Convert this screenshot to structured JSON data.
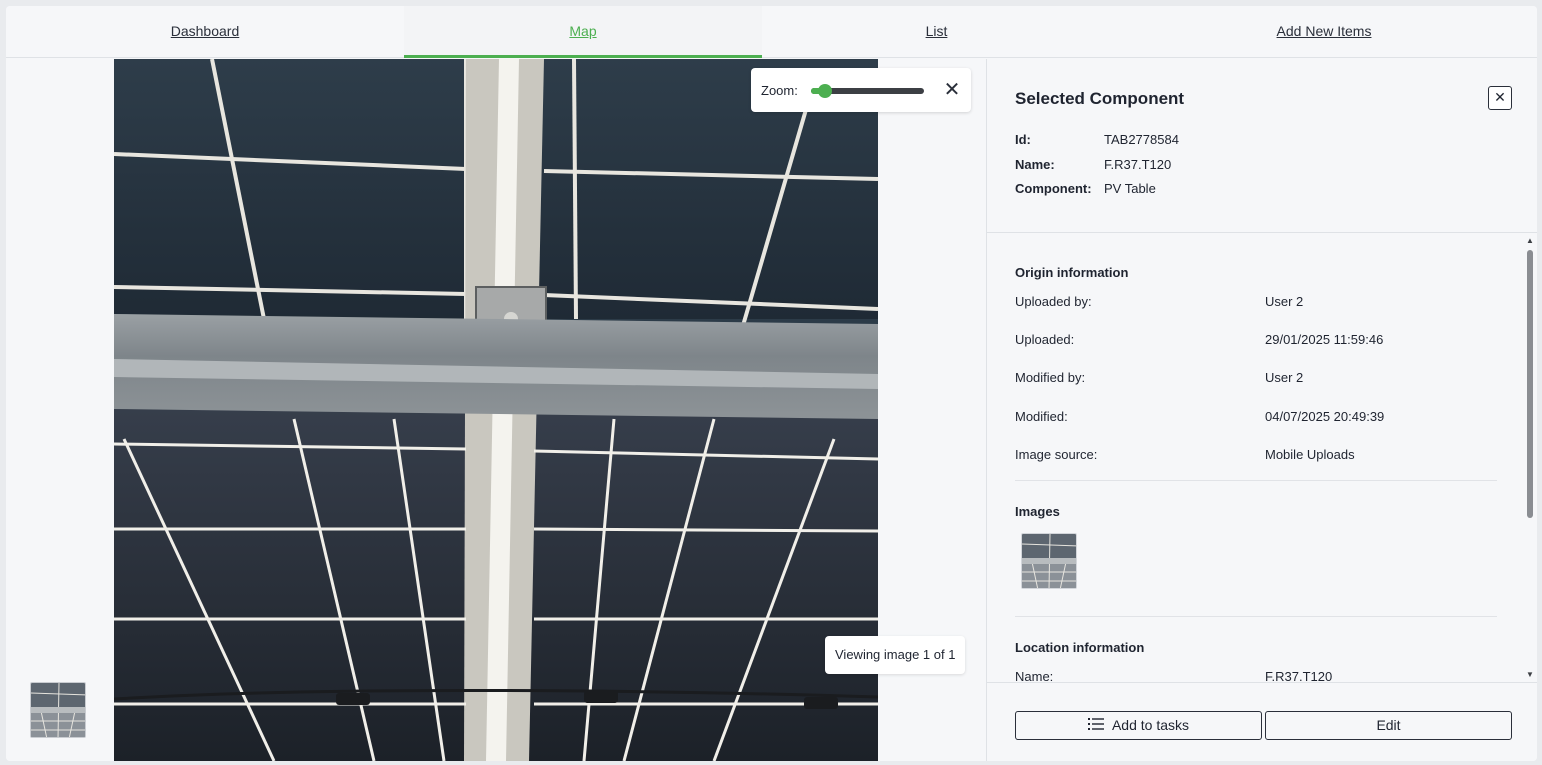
{
  "tabs": [
    {
      "label": "Dashboard"
    },
    {
      "label": "Map"
    },
    {
      "label": "List"
    },
    {
      "label": "Add New Items"
    }
  ],
  "viewer": {
    "zoom_label": "Zoom:",
    "zoom_level": 0.12,
    "close_glyph": "✕",
    "viewing_text": "Viewing image 1 of 1"
  },
  "panel": {
    "title": "Selected Component",
    "close_glyph": "✕",
    "fields": [
      {
        "label": "Id:",
        "value": "TAB2778584"
      },
      {
        "label": "Name:",
        "value": "F.R37.T120"
      },
      {
        "label": "Component:",
        "value": "PV Table"
      }
    ],
    "origin": {
      "title": "Origin information",
      "rows": [
        {
          "label": "Uploaded by:",
          "value": "User 2"
        },
        {
          "label": "Uploaded:",
          "value": "29/01/2025 11:59:46"
        },
        {
          "label": "Modified by:",
          "value": "User 2"
        },
        {
          "label": "Modified:",
          "value": "04/07/2025 20:49:39"
        },
        {
          "label": "Image source:",
          "value": "Mobile Uploads"
        }
      ]
    },
    "images": {
      "title": "Images"
    },
    "location": {
      "title": "Location information",
      "rows": [
        {
          "label": "Name:",
          "value": "F.R37.T120"
        }
      ]
    },
    "buttons": {
      "add_to_tasks": "Add to tasks",
      "edit": "Edit"
    }
  },
  "colors": {
    "accent": "#4caf50",
    "panel_bg": "#f6f7f9",
    "text": "#1f2430"
  },
  "icons": [
    "close-icon",
    "list-icon",
    "chevron-up-icon",
    "chevron-down-icon"
  ]
}
